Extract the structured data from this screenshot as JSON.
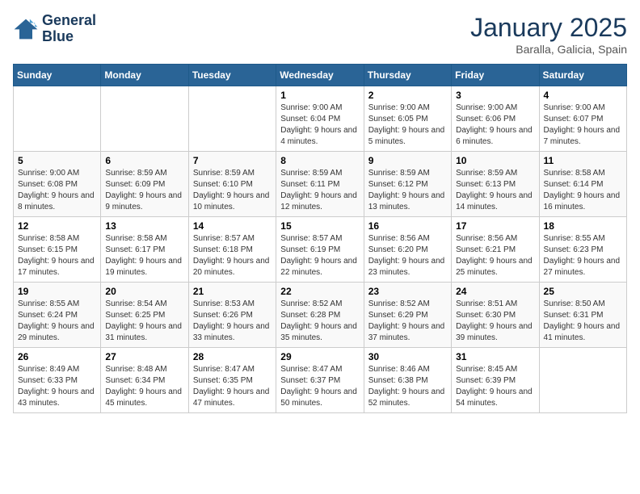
{
  "header": {
    "logo_line1": "General",
    "logo_line2": "Blue",
    "month_title": "January 2025",
    "location": "Baralla, Galicia, Spain"
  },
  "weekdays": [
    "Sunday",
    "Monday",
    "Tuesday",
    "Wednesday",
    "Thursday",
    "Friday",
    "Saturday"
  ],
  "weeks": [
    [
      {
        "day": "",
        "sunrise": "",
        "sunset": "",
        "daylight": ""
      },
      {
        "day": "",
        "sunrise": "",
        "sunset": "",
        "daylight": ""
      },
      {
        "day": "",
        "sunrise": "",
        "sunset": "",
        "daylight": ""
      },
      {
        "day": "1",
        "sunrise": "Sunrise: 9:00 AM",
        "sunset": "Sunset: 6:04 PM",
        "daylight": "Daylight: 9 hours and 4 minutes."
      },
      {
        "day": "2",
        "sunrise": "Sunrise: 9:00 AM",
        "sunset": "Sunset: 6:05 PM",
        "daylight": "Daylight: 9 hours and 5 minutes."
      },
      {
        "day": "3",
        "sunrise": "Sunrise: 9:00 AM",
        "sunset": "Sunset: 6:06 PM",
        "daylight": "Daylight: 9 hours and 6 minutes."
      },
      {
        "day": "4",
        "sunrise": "Sunrise: 9:00 AM",
        "sunset": "Sunset: 6:07 PM",
        "daylight": "Daylight: 9 hours and 7 minutes."
      }
    ],
    [
      {
        "day": "5",
        "sunrise": "Sunrise: 9:00 AM",
        "sunset": "Sunset: 6:08 PM",
        "daylight": "Daylight: 9 hours and 8 minutes."
      },
      {
        "day": "6",
        "sunrise": "Sunrise: 8:59 AM",
        "sunset": "Sunset: 6:09 PM",
        "daylight": "Daylight: 9 hours and 9 minutes."
      },
      {
        "day": "7",
        "sunrise": "Sunrise: 8:59 AM",
        "sunset": "Sunset: 6:10 PM",
        "daylight": "Daylight: 9 hours and 10 minutes."
      },
      {
        "day": "8",
        "sunrise": "Sunrise: 8:59 AM",
        "sunset": "Sunset: 6:11 PM",
        "daylight": "Daylight: 9 hours and 12 minutes."
      },
      {
        "day": "9",
        "sunrise": "Sunrise: 8:59 AM",
        "sunset": "Sunset: 6:12 PM",
        "daylight": "Daylight: 9 hours and 13 minutes."
      },
      {
        "day": "10",
        "sunrise": "Sunrise: 8:59 AM",
        "sunset": "Sunset: 6:13 PM",
        "daylight": "Daylight: 9 hours and 14 minutes."
      },
      {
        "day": "11",
        "sunrise": "Sunrise: 8:58 AM",
        "sunset": "Sunset: 6:14 PM",
        "daylight": "Daylight: 9 hours and 16 minutes."
      }
    ],
    [
      {
        "day": "12",
        "sunrise": "Sunrise: 8:58 AM",
        "sunset": "Sunset: 6:15 PM",
        "daylight": "Daylight: 9 hours and 17 minutes."
      },
      {
        "day": "13",
        "sunrise": "Sunrise: 8:58 AM",
        "sunset": "Sunset: 6:17 PM",
        "daylight": "Daylight: 9 hours and 19 minutes."
      },
      {
        "day": "14",
        "sunrise": "Sunrise: 8:57 AM",
        "sunset": "Sunset: 6:18 PM",
        "daylight": "Daylight: 9 hours and 20 minutes."
      },
      {
        "day": "15",
        "sunrise": "Sunrise: 8:57 AM",
        "sunset": "Sunset: 6:19 PM",
        "daylight": "Daylight: 9 hours and 22 minutes."
      },
      {
        "day": "16",
        "sunrise": "Sunrise: 8:56 AM",
        "sunset": "Sunset: 6:20 PM",
        "daylight": "Daylight: 9 hours and 23 minutes."
      },
      {
        "day": "17",
        "sunrise": "Sunrise: 8:56 AM",
        "sunset": "Sunset: 6:21 PM",
        "daylight": "Daylight: 9 hours and 25 minutes."
      },
      {
        "day": "18",
        "sunrise": "Sunrise: 8:55 AM",
        "sunset": "Sunset: 6:23 PM",
        "daylight": "Daylight: 9 hours and 27 minutes."
      }
    ],
    [
      {
        "day": "19",
        "sunrise": "Sunrise: 8:55 AM",
        "sunset": "Sunset: 6:24 PM",
        "daylight": "Daylight: 9 hours and 29 minutes."
      },
      {
        "day": "20",
        "sunrise": "Sunrise: 8:54 AM",
        "sunset": "Sunset: 6:25 PM",
        "daylight": "Daylight: 9 hours and 31 minutes."
      },
      {
        "day": "21",
        "sunrise": "Sunrise: 8:53 AM",
        "sunset": "Sunset: 6:26 PM",
        "daylight": "Daylight: 9 hours and 33 minutes."
      },
      {
        "day": "22",
        "sunrise": "Sunrise: 8:52 AM",
        "sunset": "Sunset: 6:28 PM",
        "daylight": "Daylight: 9 hours and 35 minutes."
      },
      {
        "day": "23",
        "sunrise": "Sunrise: 8:52 AM",
        "sunset": "Sunset: 6:29 PM",
        "daylight": "Daylight: 9 hours and 37 minutes."
      },
      {
        "day": "24",
        "sunrise": "Sunrise: 8:51 AM",
        "sunset": "Sunset: 6:30 PM",
        "daylight": "Daylight: 9 hours and 39 minutes."
      },
      {
        "day": "25",
        "sunrise": "Sunrise: 8:50 AM",
        "sunset": "Sunset: 6:31 PM",
        "daylight": "Daylight: 9 hours and 41 minutes."
      }
    ],
    [
      {
        "day": "26",
        "sunrise": "Sunrise: 8:49 AM",
        "sunset": "Sunset: 6:33 PM",
        "daylight": "Daylight: 9 hours and 43 minutes."
      },
      {
        "day": "27",
        "sunrise": "Sunrise: 8:48 AM",
        "sunset": "Sunset: 6:34 PM",
        "daylight": "Daylight: 9 hours and 45 minutes."
      },
      {
        "day": "28",
        "sunrise": "Sunrise: 8:47 AM",
        "sunset": "Sunset: 6:35 PM",
        "daylight": "Daylight: 9 hours and 47 minutes."
      },
      {
        "day": "29",
        "sunrise": "Sunrise: 8:47 AM",
        "sunset": "Sunset: 6:37 PM",
        "daylight": "Daylight: 9 hours and 50 minutes."
      },
      {
        "day": "30",
        "sunrise": "Sunrise: 8:46 AM",
        "sunset": "Sunset: 6:38 PM",
        "daylight": "Daylight: 9 hours and 52 minutes."
      },
      {
        "day": "31",
        "sunrise": "Sunrise: 8:45 AM",
        "sunset": "Sunset: 6:39 PM",
        "daylight": "Daylight: 9 hours and 54 minutes."
      },
      {
        "day": "",
        "sunrise": "",
        "sunset": "",
        "daylight": ""
      }
    ]
  ]
}
